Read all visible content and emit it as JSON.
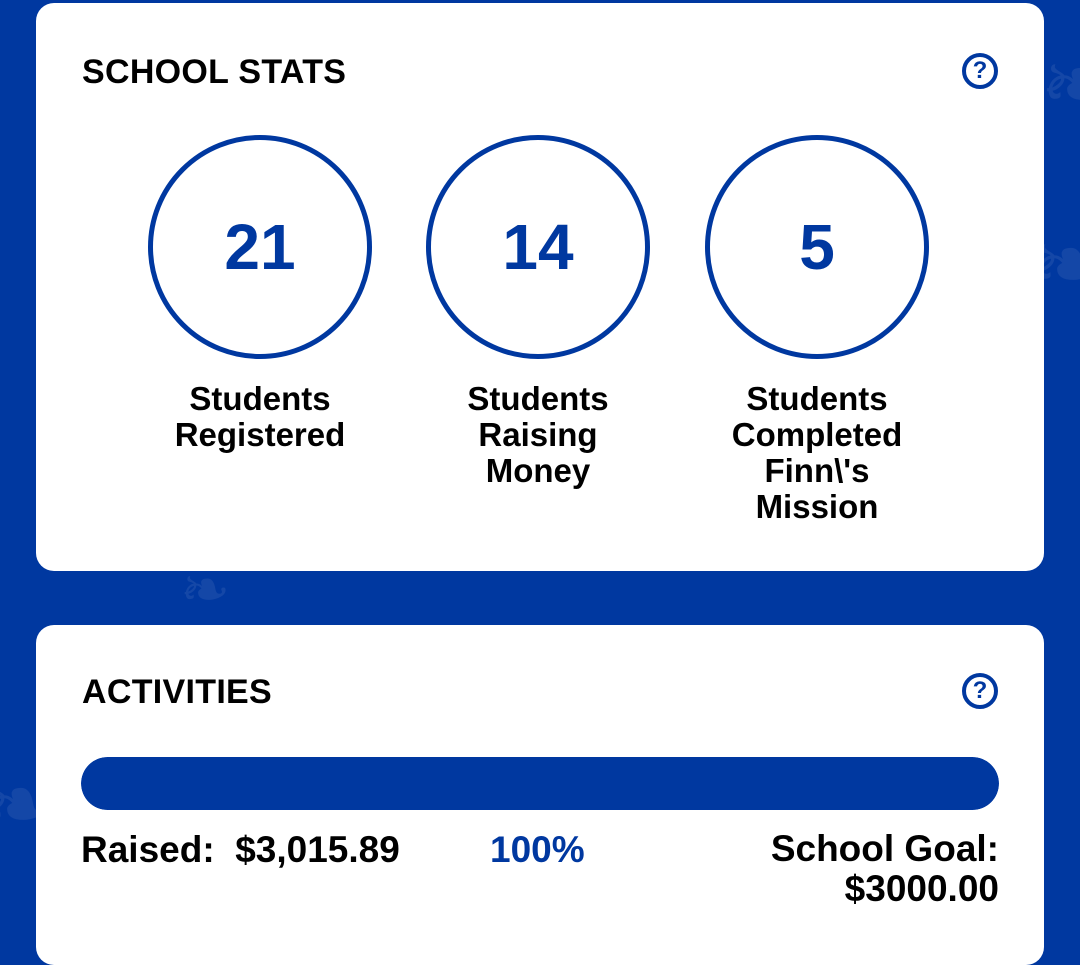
{
  "school_stats": {
    "title": "SCHOOL STATS",
    "help_symbol": "?",
    "stats": [
      {
        "value": "21",
        "label": "Students\nRegistered"
      },
      {
        "value": "14",
        "label": "Students\nRaising\nMoney"
      },
      {
        "value": "5",
        "label": "Students\nCompleted\nFinn\\'s\nMission"
      }
    ]
  },
  "activities": {
    "title": "ACTIVITIES",
    "help_symbol": "?",
    "progress_fraction": 1.0,
    "raised_label": "Raised:",
    "raised_amount": "$3,015.89",
    "percent": "100%",
    "goal_label": "School Goal:",
    "goal_amount": "$3000.00"
  },
  "colors": {
    "brand_blue": "#0038a0",
    "card_background": "#ffffff"
  },
  "icons": [
    "help-circle-icon"
  ]
}
